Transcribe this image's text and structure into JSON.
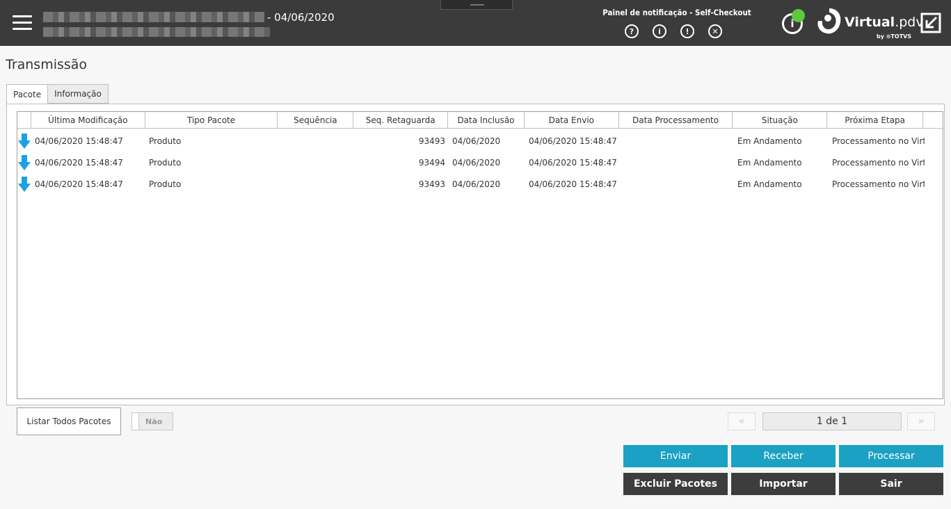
{
  "header": {
    "title_suffix": "- 04/06/2020",
    "notification_title": "Painel de notificação - Self-Checkout",
    "notification_icons": [
      {
        "name": "help-icon",
        "glyph": "?"
      },
      {
        "name": "info-icon",
        "glyph": "i"
      },
      {
        "name": "warning-icon",
        "glyph": "!"
      },
      {
        "name": "error-icon",
        "glyph": "✕"
      }
    ],
    "info_glyph": "i",
    "status_color": "#5cc93f",
    "logo_main": "Virtual",
    "logo_suffix": ".pdv",
    "logo_by": "by ⊙TOTVS"
  },
  "page": {
    "title": "Transmissão",
    "tabs": [
      {
        "label": "Pacote",
        "active": true
      },
      {
        "label": "Informação",
        "active": false
      }
    ]
  },
  "grid": {
    "columns": [
      "Última Modificação",
      "Tipo Pacote",
      "Sequência",
      "Seq. Retaguarda",
      "Data Inclusão",
      "Data Envio",
      "Data Processamento",
      "Situação",
      "Próxima Etapa"
    ],
    "rows": [
      {
        "ultima": "04/06/2020 15:48:47",
        "tipo": "Produto",
        "sequencia": "",
        "seq_ret": "93493",
        "inclusao": "04/06/2020",
        "envio": "04/06/2020 15:48:47",
        "processamento": "",
        "situacao": "Em Andamento",
        "proxima": "Processamento no Virtua"
      },
      {
        "ultima": "04/06/2020 15:48:47",
        "tipo": "Produto",
        "sequencia": "",
        "seq_ret": "93494",
        "inclusao": "04/06/2020",
        "envio": "04/06/2020 15:48:47",
        "processamento": "",
        "situacao": "Em Andamento",
        "proxima": "Processamento no Virtua"
      },
      {
        "ultima": "04/06/2020 15:48:47",
        "tipo": "Produto",
        "sequencia": "",
        "seq_ret": "93493",
        "inclusao": "04/06/2020",
        "envio": "04/06/2020 15:48:47",
        "processamento": "",
        "situacao": "Em Andamento",
        "proxima": "Processamento no Virtua"
      }
    ],
    "row_icon": "download-arrow-icon",
    "row_icon_color": "#1ba1e4"
  },
  "footer": {
    "listar_label": "Listar Todos Pacotes",
    "toggle_label": "Não",
    "pager_first": "«",
    "pager_last": "»",
    "pager_info": "1 de 1"
  },
  "actions": {
    "enviar": "Enviar",
    "receber": "Receber",
    "processar": "Processar",
    "excluir": "Excluir Pacotes",
    "importar": "Importar",
    "sair": "Sair"
  }
}
